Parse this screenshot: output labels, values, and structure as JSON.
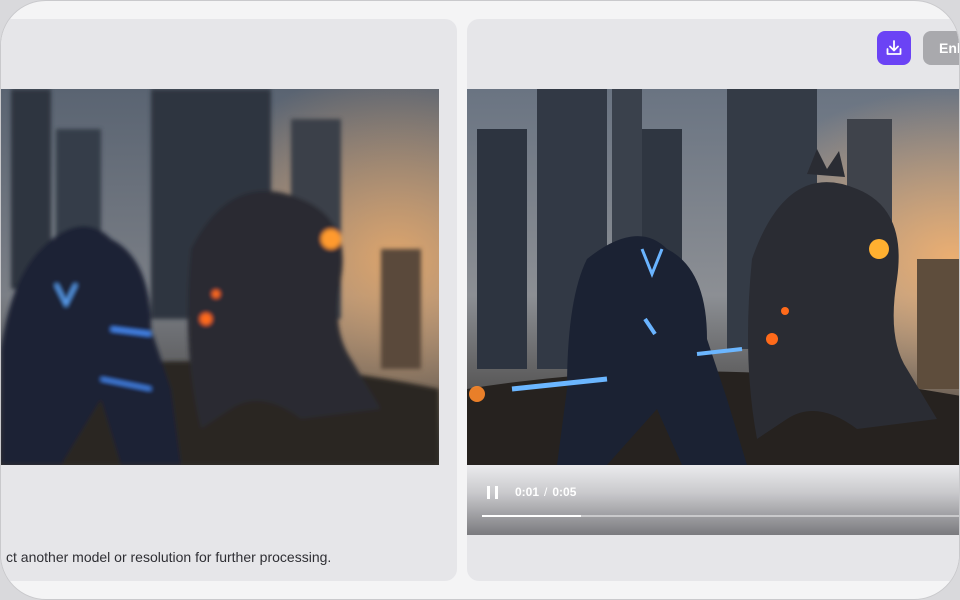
{
  "left_panel": {
    "hint_text": "ct another model or resolution for further processing."
  },
  "right_panel": {
    "download_icon": "download-icon",
    "enhance_label": "Enh",
    "player": {
      "pause_icon": "pause-icon",
      "current_time": "0:01",
      "separator": "/",
      "duration": "0:05",
      "progress": 0.2
    }
  },
  "colors": {
    "accent": "#6b43f5",
    "panel_bg": "#e6e6e9",
    "disabled_button": "#a9a9ad"
  }
}
